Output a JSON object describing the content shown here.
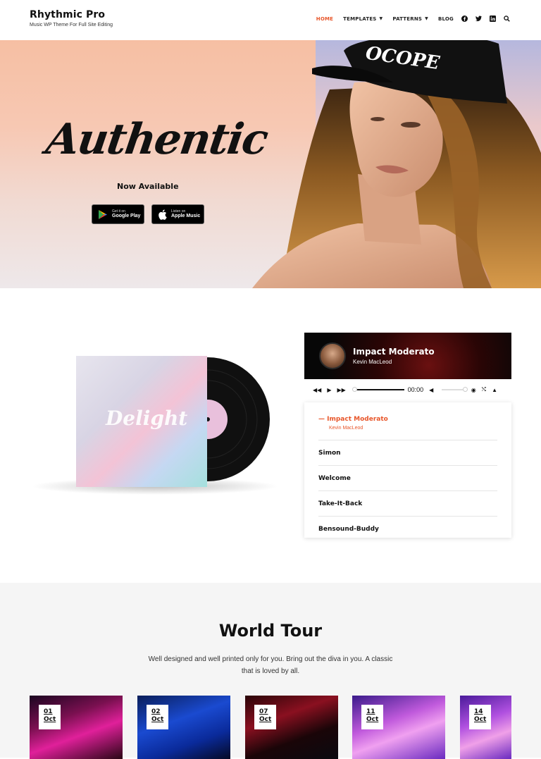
{
  "brand": {
    "title": "Rhythmic Pro",
    "tagline": "Music WP Theme For Full Site Editing"
  },
  "nav": {
    "home": "HOME",
    "templates": "TEMPLATES",
    "patterns": "PATTERNS",
    "blog": "BLOG"
  },
  "social_icons": [
    "facebook-icon",
    "twitter-icon",
    "linkedin-icon",
    "search-icon"
  ],
  "hero": {
    "title": "Authentic",
    "subtitle": "Now Available",
    "google_small": "Get it on",
    "google_large": "Google Play",
    "apple_small": "Listen on",
    "apple_large": "Apple Music"
  },
  "album": {
    "cover_text": "Delight"
  },
  "player": {
    "song": "Impact Moderato",
    "artist": "Kevin MacLeod",
    "time": "00:00",
    "playlist": [
      {
        "title": "Impact Moderato",
        "artist": "Kevin MacLeod",
        "current": true
      },
      {
        "title": "Simon"
      },
      {
        "title": "Welcome"
      },
      {
        "title": "Take-It-Back"
      },
      {
        "title": "Bensound-Buddy"
      }
    ]
  },
  "tour": {
    "title": "World Tour",
    "description": "Well designed and well printed only for you. Bring out the diva in you. A classic that is loved by all.",
    "events": [
      {
        "day": "01",
        "month": "Oct"
      },
      {
        "day": "02",
        "month": "Oct"
      },
      {
        "day": "07",
        "month": "Oct"
      },
      {
        "day": "11",
        "month": "Oct"
      },
      {
        "day": "14",
        "month": "Oct"
      }
    ]
  },
  "colors": {
    "accent": "#e8562a",
    "dark": "#111111",
    "section_bg": "#f5f5f5"
  }
}
